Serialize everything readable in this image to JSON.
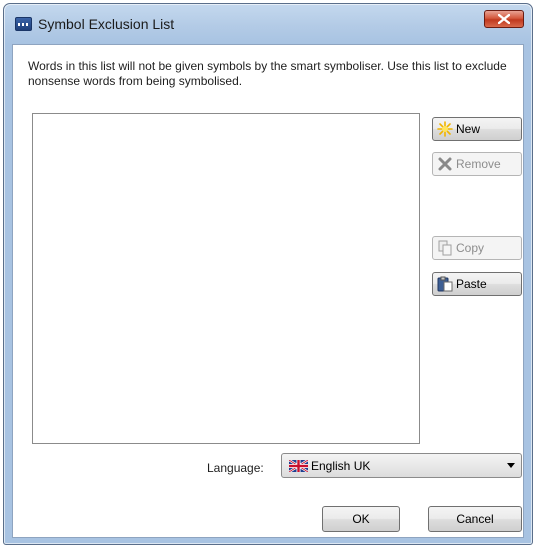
{
  "window": {
    "title": "Symbol Exclusion List"
  },
  "description": "Words in this list will not be given symbols by the smart symboliser. Use this list to exclude nonsense words from being symbolised.",
  "side_buttons": {
    "new_label": "New",
    "remove_label": "Remove",
    "copy_label": "Copy",
    "paste_label": "Paste"
  },
  "language": {
    "label": "Language:",
    "selected": "English UK",
    "flag_icon": "uk-flag-icon"
  },
  "dialog_buttons": {
    "ok_label": "OK",
    "cancel_label": "Cancel"
  },
  "icons": {
    "app": "app-icon",
    "close": "close-icon",
    "new": "new-star-icon",
    "remove": "remove-x-icon",
    "copy": "copy-icon",
    "paste": "paste-icon",
    "dropdown": "chevron-down-icon"
  },
  "colors": {
    "frame": "#a8c3e2",
    "close_button": "#c9472b",
    "new_star": "#f5c518"
  }
}
